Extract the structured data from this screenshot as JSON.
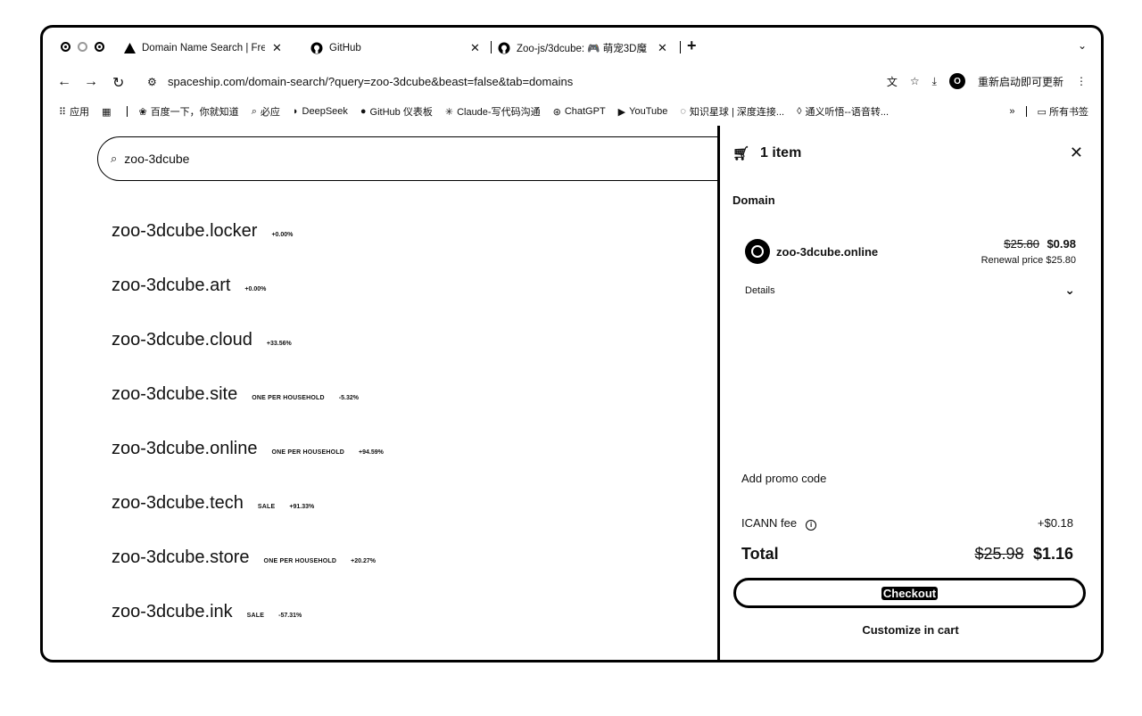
{
  "tabs": [
    {
      "title": "Domain Name Search | Free D",
      "icon": "spaceship-icon"
    },
    {
      "title": "GitHub",
      "icon": "github-icon"
    },
    {
      "title": "Zoo-js/3dcube: 🎮 萌宠3D魔",
      "icon": "github-icon"
    }
  ],
  "address": {
    "url": "spaceship.com/domain-search/?query=zoo-3dcube&beast=false&tab=domains",
    "profile_initial": "O",
    "restart_label": "重新启动即可更新"
  },
  "bookmarks": {
    "apps_label": "应用",
    "items": [
      {
        "label": "百度一下，你就知道",
        "icon": "baidu-icon"
      },
      {
        "label": "必应",
        "icon": "bing-icon"
      },
      {
        "label": "DeepSeek",
        "icon": "deepseek-icon"
      },
      {
        "label": "GitHub 仪表板",
        "icon": "github-icon"
      },
      {
        "label": "Claude-写代码沟通",
        "icon": "claude-icon"
      },
      {
        "label": "ChatGPT",
        "icon": "chatgpt-icon"
      },
      {
        "label": "YouTube",
        "icon": "youtube-icon"
      },
      {
        "label": "知识星球 | 深度连接...",
        "icon": "zsxq-icon"
      },
      {
        "label": "通义听悟--语音转...",
        "icon": "tingwu-icon"
      }
    ],
    "all_bookmarks_label": "所有书签"
  },
  "search": {
    "value": "zoo-3dcube"
  },
  "results": [
    {
      "name": "zoo-3dcube.locker",
      "tag": "",
      "change": "+0.00%"
    },
    {
      "name": "zoo-3dcube.art",
      "tag": "",
      "change": "+0.00%"
    },
    {
      "name": "zoo-3dcube.cloud",
      "tag": "",
      "change": "+33.56%"
    },
    {
      "name": "zoo-3dcube.site",
      "tag": "ONE PER HOUSEHOLD",
      "change": "-5.32%"
    },
    {
      "name": "zoo-3dcube.online",
      "tag": "ONE PER HOUSEHOLD",
      "change": "+94.59%"
    },
    {
      "name": "zoo-3dcube.tech",
      "tag": "SALE",
      "change": "+91.33%"
    },
    {
      "name": "zoo-3dcube.store",
      "tag": "ONE PER HOUSEHOLD",
      "change": "+20.27%"
    },
    {
      "name": "zoo-3dcube.ink",
      "tag": "SALE",
      "change": "-57.31%"
    }
  ],
  "cart": {
    "count_label": "1 item",
    "section": "Domain",
    "item": {
      "name": "zoo-3dcube.online",
      "old_price": "$25.80",
      "price": "$0.98",
      "renewal": "Renewal price $25.80"
    },
    "details_label": "Details",
    "promo_label": "Add promo code",
    "icann_label": "ICANN fee",
    "icann_value": "+$0.18",
    "total_label": "Total",
    "total_old": "$25.98",
    "total_new": "$1.16",
    "checkout_label": "Checkout",
    "customize_label": "Customize in cart"
  }
}
